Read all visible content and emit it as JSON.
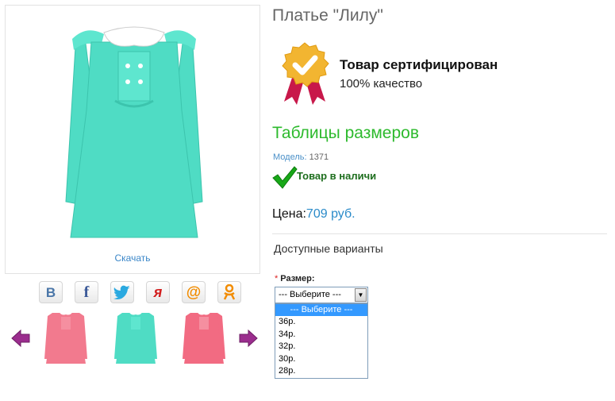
{
  "product": {
    "title": "Платье \"Лилу\"",
    "download_label": "Скачать"
  },
  "certificate": {
    "title": "Товар сертифицирован",
    "subtitle": "100% качество"
  },
  "size_table_link": "Таблицы размеров",
  "model": {
    "label": "Модель:",
    "value": "1371"
  },
  "stock": {
    "text": "Товар в наличи",
    "icon": "green-checkmark-icon"
  },
  "price": {
    "label": "Цена:",
    "value": "709 руб."
  },
  "options": {
    "heading": "Доступные варианты",
    "size": {
      "required_mark": "*",
      "label": "Размер:",
      "selected": "--- Выберите ---",
      "list": [
        "--- Выберите ---",
        "36р.",
        "34р.",
        "32р.",
        "30р.",
        "28р."
      ]
    }
  },
  "share": [
    {
      "icon": "vkontakte-icon",
      "glyph": "B",
      "color": "#4a76a8"
    },
    {
      "icon": "facebook-icon",
      "glyph": "f",
      "color": "#3b5998"
    },
    {
      "icon": "twitter-icon",
      "glyph": "",
      "color": "#2aa9e0"
    },
    {
      "icon": "yaru-icon",
      "glyph": "я",
      "color": "#d21f1f"
    },
    {
      "icon": "mailru-icon",
      "glyph": "@",
      "color": "#f28c00"
    },
    {
      "icon": "odnoklassniki-icon",
      "glyph": "ok",
      "color": "#f28c00"
    }
  ],
  "colors": {
    "accent_green": "#2dba2d",
    "link_blue": "#3a86c8",
    "dress_mint": "#4fdcc4",
    "dress_pink": "#f27a8e",
    "arrow_purple": "#9b2d8e"
  }
}
